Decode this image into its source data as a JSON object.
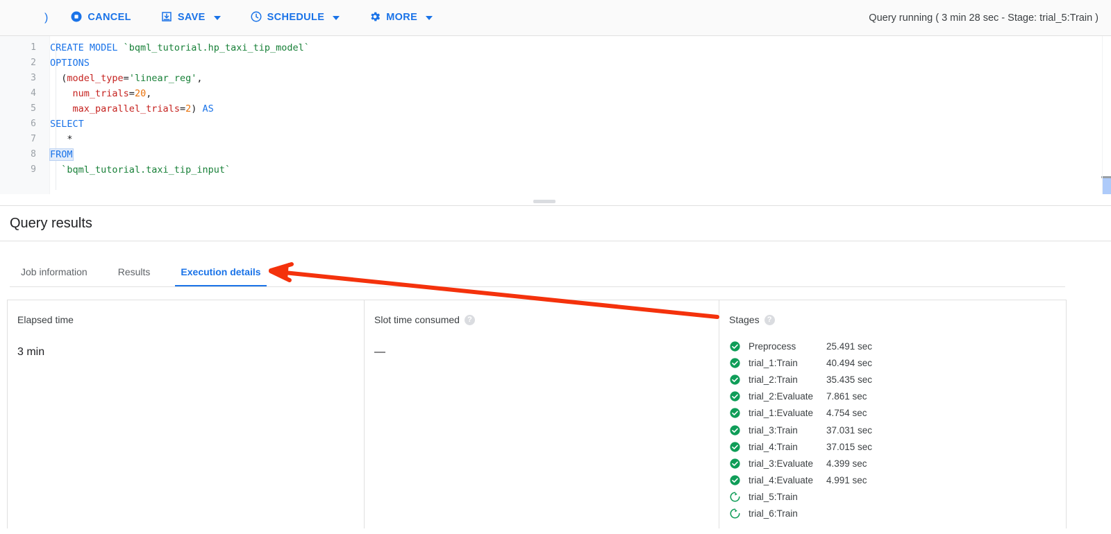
{
  "toolbar": {
    "paren": ")",
    "buttons": [
      {
        "label": "CANCEL",
        "icon": "stop-circle-icon",
        "caret": false
      },
      {
        "label": "SAVE",
        "icon": "save-icon",
        "caret": true
      },
      {
        "label": "SCHEDULE",
        "icon": "clock-icon",
        "caret": true
      },
      {
        "label": "MORE",
        "icon": "gear-icon",
        "caret": true
      }
    ],
    "status": "Query running ( 3 min 28 sec - Stage: trial_5:Train )"
  },
  "editor": {
    "line_numbers": [
      "1",
      "2",
      "3",
      "4",
      "5",
      "6",
      "7",
      "8",
      "9"
    ],
    "lines": [
      "CREATE MODEL `bqml_tutorial.hp_taxi_tip_model`",
      "OPTIONS",
      "  (model_type='linear_reg',",
      "    num_trials=20,",
      "    max_parallel_trials=2) AS",
      "SELECT",
      "  *",
      "FROM",
      "  `bqml_tutorial.taxi_tip_input`"
    ]
  },
  "results": {
    "title": "Query results",
    "tabs": [
      {
        "label": "Job information",
        "active": false
      },
      {
        "label": "Results",
        "active": false
      },
      {
        "label": "Execution details",
        "active": true
      }
    ]
  },
  "panels": {
    "elapsed": {
      "title": "Elapsed time",
      "value": "3 min"
    },
    "slot_time": {
      "title": "Slot time consumed",
      "value": "—",
      "help": "?"
    },
    "stages": {
      "title": "Stages",
      "help": "?"
    }
  },
  "stages": [
    {
      "name": "Preprocess",
      "time": "25.491 sec",
      "state": "complete"
    },
    {
      "name": "trial_1:Train",
      "time": "40.494 sec",
      "state": "complete"
    },
    {
      "name": "trial_2:Train",
      "time": "35.435 sec",
      "state": "complete"
    },
    {
      "name": "trial_2:Evaluate",
      "time": "7.861 sec",
      "state": "complete"
    },
    {
      "name": "trial_1:Evaluate",
      "time": "4.754 sec",
      "state": "complete"
    },
    {
      "name": "trial_3:Train",
      "time": "37.031 sec",
      "state": "complete"
    },
    {
      "name": "trial_4:Train",
      "time": "37.015 sec",
      "state": "complete"
    },
    {
      "name": "trial_3:Evaluate",
      "time": "4.399 sec",
      "state": "complete"
    },
    {
      "name": "trial_4:Evaluate",
      "time": "4.991 sec",
      "state": "complete"
    },
    {
      "name": "trial_5:Train",
      "time": "",
      "state": "running"
    },
    {
      "name": "trial_6:Train",
      "time": "",
      "state": "running"
    }
  ],
  "annotation": {
    "type": "arrow",
    "color": "#f4320c"
  },
  "colors": {
    "accent": "#1a73e8",
    "success": "#0f9d58",
    "annotation": "#f4320c",
    "text": "#202124",
    "muted": "#5f6368"
  }
}
